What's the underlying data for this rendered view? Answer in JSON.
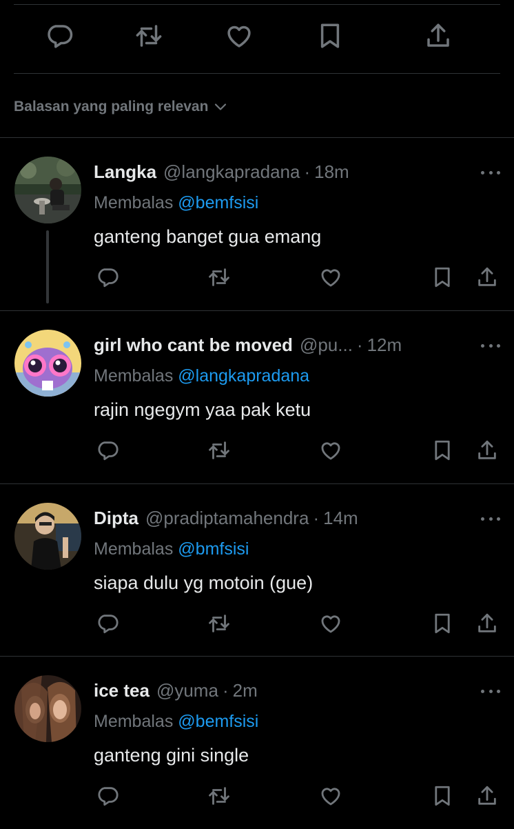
{
  "icons": {
    "reply": "speech-bubble-icon",
    "retweet": "retweet-icon",
    "like": "heart-icon",
    "bookmark": "bookmark-icon",
    "share": "share-upload-icon",
    "more": "more-horizontal-icon",
    "sort_chevron": "chevron-down-icon"
  },
  "sort": {
    "label": "Balasan yang paling relevan"
  },
  "replies": [
    {
      "name": "Langka",
      "handle": "@langkapradana",
      "dot": "·",
      "time": "18m",
      "replying_prefix": "Membalas",
      "replying_to": "@bemfsisi",
      "text": "ganteng banget gua emang"
    },
    {
      "name": "girl who cant be moved",
      "handle": "@pu...",
      "dot": "·",
      "time": "12m",
      "replying_prefix": "Membalas",
      "replying_to": "@langkapradana",
      "text": "rajin ngegym yaa pak ketu"
    },
    {
      "name": "Dipta",
      "handle": "@pradiptamahendra",
      "dot": "·",
      "time": "14m",
      "replying_prefix": "Membalas",
      "replying_to": "@bmfsisi",
      "text": "siapa dulu yg motoin (gue)"
    },
    {
      "name": "ice tea",
      "handle": "@yuma",
      "dot": "·",
      "time": "2m",
      "replying_prefix": "Membalas",
      "replying_to": "@bemfsisi",
      "text": "ganteng gini single"
    }
  ],
  "colors": {
    "background": "#000000",
    "text": "#e7e9ea",
    "muted": "#71767b",
    "link": "#1d9bf0",
    "divider": "#2f3336"
  }
}
